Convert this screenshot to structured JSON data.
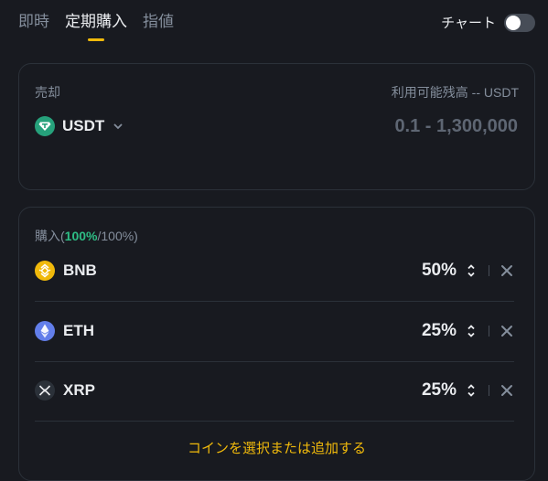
{
  "tabs": [
    {
      "label": "即時",
      "active": false
    },
    {
      "label": "定期購入",
      "active": true
    },
    {
      "label": "指値",
      "active": false
    }
  ],
  "chart_toggle": {
    "label": "チャート",
    "enabled": false
  },
  "sell": {
    "title": "売却",
    "available": "利用可能残高 -- USDT",
    "coin": "USDT",
    "coin_icon": "usdt-icon",
    "amount_placeholder": "0.1 - 1,300,000"
  },
  "buy": {
    "title_prefix": "購入(",
    "allocated": "100%",
    "title_suffix": "/100%)",
    "coins": [
      {
        "name": "BNB",
        "percent": "50%",
        "icon": "bnb-icon"
      },
      {
        "name": "ETH",
        "percent": "25%",
        "icon": "eth-icon"
      },
      {
        "name": "XRP",
        "percent": "25%",
        "icon": "xrp-icon"
      }
    ],
    "add_link": "コインを選択または追加する"
  },
  "colors": {
    "accent": "#f0b90b",
    "green": "#2ebd85",
    "usdt": "#26a17b",
    "eth": "#627eea"
  }
}
